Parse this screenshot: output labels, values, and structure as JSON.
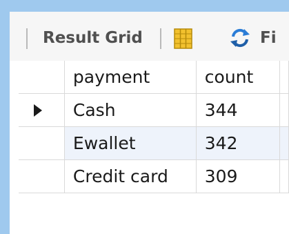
{
  "toolbar": {
    "result_grid_label": "Result Grid",
    "next_item_partial": "Fi"
  },
  "grid": {
    "columns": [
      "payment",
      "count"
    ],
    "rows": [
      {
        "payment": "Cash",
        "count": "344",
        "current": true
      },
      {
        "payment": "Ewallet",
        "count": "342",
        "current": false
      },
      {
        "payment": "Credit card",
        "count": "309",
        "current": false
      }
    ]
  },
  "colors": {
    "frame": "#9fc9ee",
    "toolbar_bg": "#f6f6f6",
    "alt_row_bg": "#eef3fb",
    "grid_icon_yellow": "#f2c12e",
    "refresh_blue": "#2a7cd6"
  },
  "icons": [
    "grid-layout-icon",
    "refresh-icon",
    "current-row-pointer-icon"
  ]
}
